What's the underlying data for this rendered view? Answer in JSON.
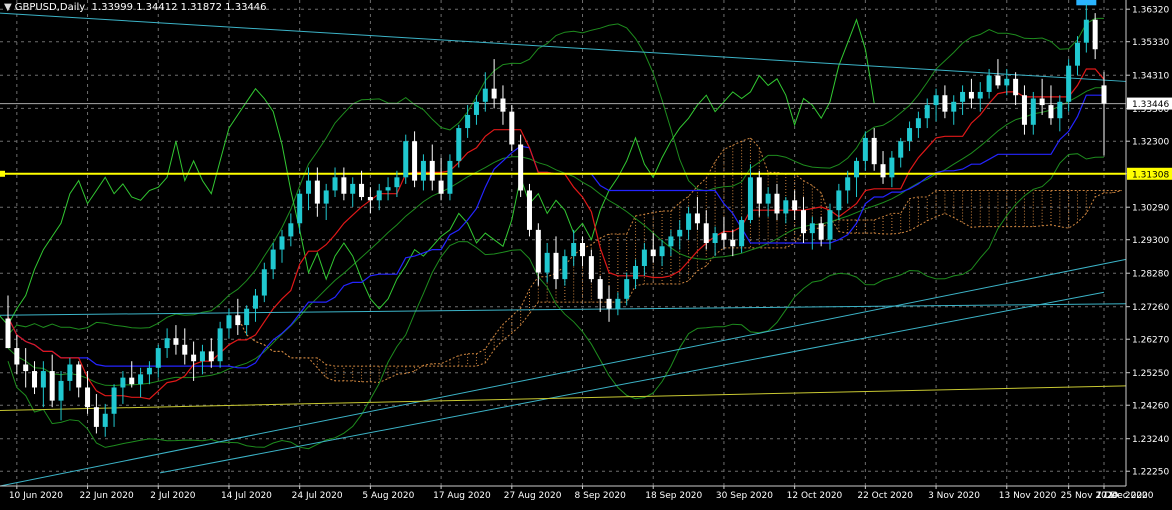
{
  "header": {
    "symbol": "GBPUSD",
    "timeframe": "Daily",
    "values": "1.33999 1.34412 1.31872 1.33446"
  },
  "colors": {
    "background": "#000000",
    "grid": "#6e6e6e",
    "bull": "#20c8d0",
    "bear": "#ffffff",
    "tenkan": "#e01818",
    "kijun": "#2424ff",
    "chikou": "#32c832",
    "bollinger": "#1e8c1e",
    "rsi_green": "#4cd84c",
    "kumo": "#cd853f",
    "trendline": "#3cb4c8",
    "support": "#ffff00",
    "low_trend": "#c8c832"
  },
  "chart_data": {
    "type": "candlestick",
    "symbol": "GBPUSD",
    "timeframe": "Daily",
    "ylim": [
      1.218,
      1.366
    ],
    "y_ticks": [
      "1.36320",
      "1.35330",
      "1.34310",
      "1.33300",
      "1.32300",
      "1.31308",
      "1.30290",
      "1.29300",
      "1.28280",
      "1.27260",
      "1.26270",
      "1.25250",
      "1.24260",
      "1.23240",
      "1.22250"
    ],
    "x_labels": [
      "10 Jun 2020",
      "22 Jun 2020",
      "2 Jul 2020",
      "14 Jul 2020",
      "24 Jul 2020",
      "5 Aug 2020",
      "17 Aug 2020",
      "27 Aug 2020",
      "8 Sep 2020",
      "18 Sep 2020",
      "30 Sep 2020",
      "12 Oct 2020",
      "22 Oct 2020",
      "3 Nov 2020",
      "13 Nov 2020",
      "25 Nov 2020",
      "7 Dec 2020",
      "17 Dec 2020"
    ],
    "horizontal_level": {
      "value": 1.31308,
      "label": "1.31308"
    },
    "current_price": {
      "value": 1.33446,
      "label": "1.33446"
    },
    "candles": [
      [
        1.269,
        1.276,
        1.263,
        1.26
      ],
      [
        1.26,
        1.264,
        1.252,
        1.255
      ],
      [
        1.255,
        1.26,
        1.248,
        1.253
      ],
      [
        1.253,
        1.256,
        1.246,
        1.248
      ],
      [
        1.248,
        1.256,
        1.242,
        1.253
      ],
      [
        1.253,
        1.258,
        1.242,
        1.244
      ],
      [
        1.244,
        1.253,
        1.238,
        1.25
      ],
      [
        1.25,
        1.257,
        1.247,
        1.255
      ],
      [
        1.255,
        1.256,
        1.245,
        1.248
      ],
      [
        1.248,
        1.253,
        1.24,
        1.242
      ],
      [
        1.242,
        1.246,
        1.234,
        1.236
      ],
      [
        1.236,
        1.243,
        1.233,
        1.24
      ],
      [
        1.24,
        1.249,
        1.236,
        1.248
      ],
      [
        1.248,
        1.253,
        1.243,
        1.251
      ],
      [
        1.251,
        1.256,
        1.248,
        1.249
      ],
      [
        1.249,
        1.254,
        1.245,
        1.252
      ],
      [
        1.252,
        1.256,
        1.249,
        1.254
      ],
      [
        1.254,
        1.261,
        1.251,
        1.26
      ],
      [
        1.26,
        1.266,
        1.257,
        1.263
      ],
      [
        1.263,
        1.267,
        1.258,
        1.261
      ],
      [
        1.261,
        1.266,
        1.255,
        1.258
      ],
      [
        1.258,
        1.262,
        1.25,
        1.256
      ],
      [
        1.256,
        1.261,
        1.252,
        1.259
      ],
      [
        1.259,
        1.263,
        1.254,
        1.256
      ],
      [
        1.256,
        1.268,
        1.254,
        1.266
      ],
      [
        1.266,
        1.272,
        1.263,
        1.27
      ],
      [
        1.27,
        1.275,
        1.264,
        1.267
      ],
      [
        1.267,
        1.273,
        1.264,
        1.272
      ],
      [
        1.272,
        1.278,
        1.268,
        1.276
      ],
      [
        1.276,
        1.286,
        1.274,
        1.284
      ],
      [
        1.284,
        1.292,
        1.281,
        1.29
      ],
      [
        1.29,
        1.296,
        1.286,
        1.294
      ],
      [
        1.294,
        1.301,
        1.291,
        1.298
      ],
      [
        1.298,
        1.308,
        1.295,
        1.307
      ],
      [
        1.307,
        1.315,
        1.302,
        1.311
      ],
      [
        1.311,
        1.315,
        1.3,
        1.304
      ],
      [
        1.304,
        1.31,
        1.299,
        1.308
      ],
      [
        1.308,
        1.315,
        1.306,
        1.312
      ],
      [
        1.312,
        1.315,
        1.305,
        1.307
      ],
      [
        1.307,
        1.312,
        1.303,
        1.31
      ],
      [
        1.31,
        1.314,
        1.305,
        1.306
      ],
      [
        1.306,
        1.309,
        1.301,
        1.305
      ],
      [
        1.305,
        1.31,
        1.302,
        1.308
      ],
      [
        1.308,
        1.312,
        1.305,
        1.309
      ],
      [
        1.309,
        1.314,
        1.306,
        1.312
      ],
      [
        1.312,
        1.325,
        1.31,
        1.323
      ],
      [
        1.323,
        1.326,
        1.309,
        1.311
      ],
      [
        1.311,
        1.319,
        1.308,
        1.317
      ],
      [
        1.317,
        1.322,
        1.308,
        1.311
      ],
      [
        1.311,
        1.318,
        1.305,
        1.307
      ],
      [
        1.307,
        1.319,
        1.305,
        1.317
      ],
      [
        1.317,
        1.328,
        1.315,
        1.327
      ],
      [
        1.327,
        1.334,
        1.324,
        1.331
      ],
      [
        1.331,
        1.337,
        1.328,
        1.335
      ],
      [
        1.335,
        1.344,
        1.332,
        1.339
      ],
      [
        1.339,
        1.348,
        1.333,
        1.336
      ],
      [
        1.336,
        1.34,
        1.328,
        1.332
      ],
      [
        1.332,
        1.334,
        1.32,
        1.322
      ],
      [
        1.322,
        1.325,
        1.306,
        1.308
      ],
      [
        1.308,
        1.31,
        1.294,
        1.296
      ],
      [
        1.296,
        1.298,
        1.279,
        1.283
      ],
      [
        1.283,
        1.292,
        1.28,
        1.289
      ],
      [
        1.289,
        1.294,
        1.278,
        1.281
      ],
      [
        1.281,
        1.29,
        1.279,
        1.288
      ],
      [
        1.288,
        1.296,
        1.285,
        1.292
      ],
      [
        1.292,
        1.294,
        1.285,
        1.288
      ],
      [
        1.288,
        1.29,
        1.28,
        1.281
      ],
      [
        1.281,
        1.282,
        1.271,
        1.275
      ],
      [
        1.275,
        1.279,
        1.268,
        1.272
      ],
      [
        1.272,
        1.277,
        1.27,
        1.275
      ],
      [
        1.275,
        1.283,
        1.273,
        1.281
      ],
      [
        1.281,
        1.287,
        1.278,
        1.285
      ],
      [
        1.285,
        1.292,
        1.282,
        1.29
      ],
      [
        1.29,
        1.295,
        1.286,
        1.288
      ],
      [
        1.288,
        1.293,
        1.285,
        1.291
      ],
      [
        1.291,
        1.296,
        1.288,
        1.294
      ],
      [
        1.294,
        1.299,
        1.29,
        1.296
      ],
      [
        1.296,
        1.303,
        1.293,
        1.301
      ],
      [
        1.301,
        1.306,
        1.296,
        1.298
      ],
      [
        1.298,
        1.302,
        1.29,
        1.292
      ],
      [
        1.292,
        1.297,
        1.288,
        1.295
      ],
      [
        1.295,
        1.3,
        1.29,
        1.293
      ],
      [
        1.293,
        1.296,
        1.288,
        1.291
      ],
      [
        1.291,
        1.3,
        1.289,
        1.299
      ],
      [
        1.299,
        1.316,
        1.298,
        1.312
      ],
      [
        1.312,
        1.314,
        1.3,
        1.304
      ],
      [
        1.304,
        1.309,
        1.3,
        1.307
      ],
      [
        1.307,
        1.31,
        1.299,
        1.301
      ],
      [
        1.301,
        1.306,
        1.298,
        1.305
      ],
      [
        1.305,
        1.308,
        1.299,
        1.302
      ],
      [
        1.302,
        1.306,
        1.292,
        1.295
      ],
      [
        1.295,
        1.3,
        1.29,
        1.298
      ],
      [
        1.298,
        1.3,
        1.291,
        1.293
      ],
      [
        1.293,
        1.304,
        1.29,
        1.302
      ],
      [
        1.302,
        1.31,
        1.299,
        1.308
      ],
      [
        1.308,
        1.314,
        1.304,
        1.312
      ],
      [
        1.312,
        1.318,
        1.306,
        1.317
      ],
      [
        1.317,
        1.326,
        1.314,
        1.324
      ],
      [
        1.324,
        1.327,
        1.314,
        1.316
      ],
      [
        1.316,
        1.32,
        1.31,
        1.312
      ],
      [
        1.312,
        1.32,
        1.309,
        1.318
      ],
      [
        1.318,
        1.324,
        1.315,
        1.323
      ],
      [
        1.323,
        1.329,
        1.32,
        1.327
      ],
      [
        1.327,
        1.332,
        1.324,
        1.33
      ],
      [
        1.33,
        1.336,
        1.327,
        1.334
      ],
      [
        1.334,
        1.339,
        1.329,
        1.337
      ],
      [
        1.337,
        1.34,
        1.33,
        1.332
      ],
      [
        1.332,
        1.337,
        1.328,
        1.335
      ],
      [
        1.335,
        1.34,
        1.331,
        1.338
      ],
      [
        1.338,
        1.342,
        1.333,
        1.336
      ],
      [
        1.336,
        1.341,
        1.332,
        1.338
      ],
      [
        1.338,
        1.345,
        1.336,
        1.343
      ],
      [
        1.343,
        1.348,
        1.339,
        1.34
      ],
      [
        1.34,
        1.345,
        1.337,
        1.342
      ],
      [
        1.342,
        1.344,
        1.334,
        1.337
      ],
      [
        1.337,
        1.34,
        1.325,
        1.328
      ],
      [
        1.328,
        1.338,
        1.325,
        1.336
      ],
      [
        1.336,
        1.342,
        1.331,
        1.334
      ],
      [
        1.334,
        1.34,
        1.328,
        1.33
      ],
      [
        1.33,
        1.337,
        1.326,
        1.335
      ],
      [
        1.335,
        1.348,
        1.332,
        1.346
      ],
      [
        1.346,
        1.355,
        1.343,
        1.353
      ],
      [
        1.353,
        1.365,
        1.35,
        1.36
      ],
      [
        1.36,
        1.362,
        1.348,
        1.351
      ],
      [
        1.34,
        1.3441,
        1.3187,
        1.3345
      ]
    ]
  }
}
